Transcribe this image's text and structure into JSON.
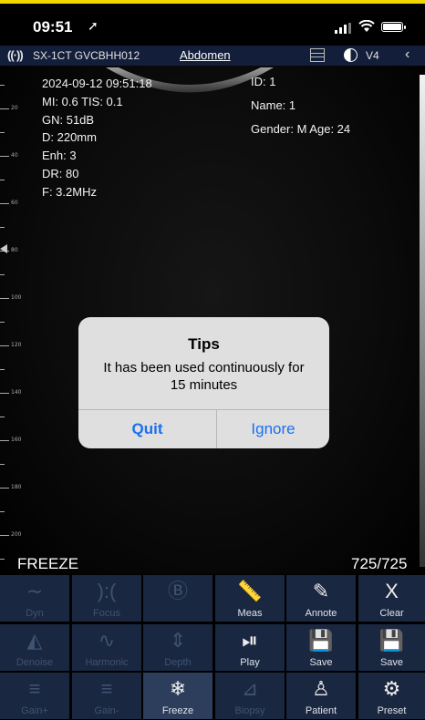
{
  "status": {
    "time": "09:51",
    "location_arrow": "➚"
  },
  "probe_bar": {
    "probe_icon": "((·))",
    "probe_name": "SX-1CT GVCBHH012",
    "preset": "Abdomen",
    "mode": "V4",
    "back_icon": "‹"
  },
  "image_info": {
    "left": [
      "2024-09-12 09:51:18",
      "MI: 0.6  TIS: 0.1",
      "GN: 51dB",
      "D: 220mm",
      "Enh: 3",
      "DR: 80",
      "F: 3.2MHz"
    ],
    "id": "ID: 1",
    "name": "Name: 1",
    "gender_age": "Gender: M   Age: 24"
  },
  "ruler_labels": [
    "20",
    "40",
    "60",
    "80",
    "100",
    "120",
    "140",
    "160",
    "180",
    "200",
    "220"
  ],
  "freeze_label": "FREEZE",
  "frame_count": "725/725",
  "dialog": {
    "title": "Tips",
    "message": "It has been used continuously for 15 minutes",
    "quit": "Quit",
    "ignore": "Ignore"
  },
  "toolbar": {
    "rows": [
      [
        {
          "label": "Dyn",
          "icon": "∼",
          "enabled": false,
          "name": "dyn"
        },
        {
          "label": "Focus",
          "icon": "):(",
          "enabled": false,
          "name": "focus"
        },
        {
          "label": "",
          "icon": "Ⓑ",
          "enabled": false,
          "name": "b-mode"
        },
        {
          "label": "Meas",
          "icon": "📏",
          "enabled": true,
          "name": "meas"
        },
        {
          "label": "Annote",
          "icon": "✎",
          "enabled": true,
          "name": "annote"
        },
        {
          "label": "Clear",
          "icon": "X",
          "enabled": true,
          "name": "clear"
        }
      ],
      [
        {
          "label": "Denoise",
          "icon": "◭",
          "enabled": false,
          "name": "denoise"
        },
        {
          "label": "Harmonic",
          "icon": "∿",
          "enabled": false,
          "name": "harmonic"
        },
        {
          "label": "Depth",
          "icon": "⇕",
          "enabled": false,
          "name": "depth"
        },
        {
          "label": "Play",
          "icon": "⏯",
          "enabled": true,
          "name": "play"
        },
        {
          "label": "Save",
          "icon": "💾",
          "enabled": true,
          "name": "save-image"
        },
        {
          "label": "Save",
          "icon": "💾",
          "enabled": true,
          "name": "save-video"
        }
      ],
      [
        {
          "label": "Gain+",
          "icon": "≡",
          "enabled": false,
          "name": "gain-plus"
        },
        {
          "label": "Gain-",
          "icon": "≡",
          "enabled": false,
          "name": "gain-minus"
        },
        {
          "label": "Freeze",
          "icon": "❄",
          "enabled": true,
          "name": "freeze",
          "active": true
        },
        {
          "label": "Biopsy",
          "icon": "⊿",
          "enabled": false,
          "name": "biopsy"
        },
        {
          "label": "Patient",
          "icon": "♙",
          "enabled": true,
          "name": "patient"
        },
        {
          "label": "Preset",
          "icon": "⚙",
          "enabled": true,
          "name": "preset"
        }
      ]
    ]
  },
  "colors": {
    "accent_blue": "#1a6ff2",
    "toolbar_bg": "#1a2740",
    "probe_bar_bg": "#131f3a",
    "status_yellow": "#f2d400"
  }
}
